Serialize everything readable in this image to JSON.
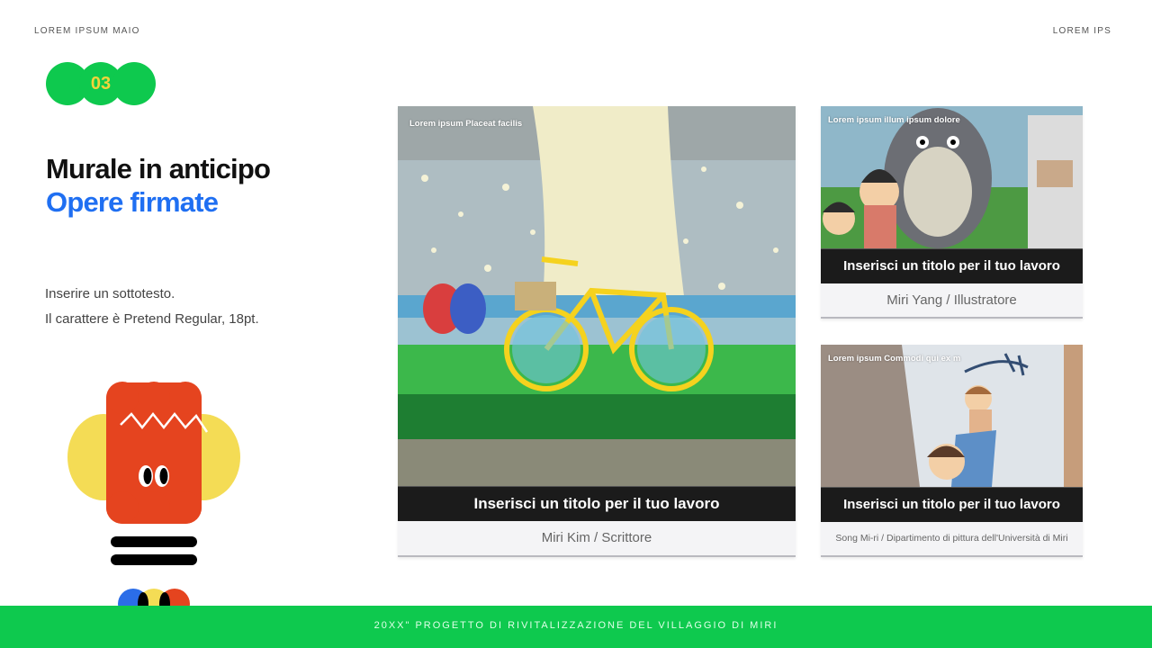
{
  "header": {
    "left": "LOREM IPSUM MAIO",
    "right": "LOREM IPS"
  },
  "badge": {
    "number": "03"
  },
  "heading": {
    "line1": "Murale in anticipo",
    "line2": "Opere firmate"
  },
  "subtext": {
    "line1": "Inserire un sottotesto.",
    "line2": "Il carattere è Pretend Regular, 18pt."
  },
  "cards": [
    {
      "image_label": "Lorem ipsum Placeat facilis",
      "title": "Inserisci un titolo per il tuo lavoro",
      "caption": "Miri Kim / Scrittore"
    },
    {
      "image_label": "Lorem ipsum illum ipsum dolore",
      "title": "Inserisci un titolo per il tuo lavoro",
      "caption": "Miri Yang / Illustratore"
    },
    {
      "image_label": "Lorem ipsum Commodi qui ex m",
      "title": "Inserisci un titolo per il tuo lavoro",
      "caption": "Song Mi-ri / Dipartimento di pittura dell'Università di Miri"
    }
  ],
  "footer": {
    "text": "20XX\" PROGETTO DI RIVITALIZZAZIONE DEL VILLAGGIO DI MIRI"
  },
  "colors": {
    "accent_green": "#0ec94e",
    "accent_blue": "#1f6ff2",
    "badge_text": "#f2d43a",
    "mascot_red": "#e5441f",
    "mascot_yellow": "#f4dc55"
  }
}
